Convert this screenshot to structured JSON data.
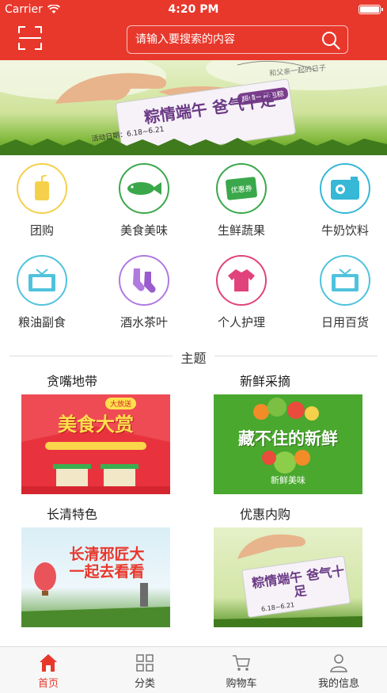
{
  "status_bar": {
    "carrier": "Carrier",
    "time": "4:20 PM"
  },
  "header": {
    "search_placeholder": "请输入要搜索的内容"
  },
  "banner": {
    "headline": "粽情端午 爸气十足",
    "date_text": "活动日期：6.18~6.21",
    "tag_text": "超值一起包粽",
    "caption": "和父亲一起的日子"
  },
  "categories": [
    {
      "label": "团购",
      "icon": "cup-icon",
      "color": "#f5d04a"
    },
    {
      "label": "美食美味",
      "icon": "fish-icon",
      "color": "#3aa84a"
    },
    {
      "label": "生鲜蔬果",
      "icon": "coupon-icon",
      "color": "#3aa84a"
    },
    {
      "label": "牛奶饮料",
      "icon": "camera-icon",
      "color": "#36b8d6"
    },
    {
      "label": "粮油副食",
      "icon": "tv-icon",
      "color": "#4fc3dc"
    },
    {
      "label": "酒水茶叶",
      "icon": "socks-icon",
      "color": "#b07adf"
    },
    {
      "label": "个人护理",
      "icon": "shirt-icon",
      "color": "#e2427c"
    },
    {
      "label": "日用百货",
      "icon": "tv-icon",
      "color": "#4fc3dc"
    }
  ],
  "coupon_text": "优惠券",
  "section_title": "主题",
  "themes": [
    {
      "label": "贪嘴地带",
      "image_text": "美食大赏",
      "badge": "大放送"
    },
    {
      "label": "新鲜采摘",
      "image_text": "藏不住的新鲜",
      "sub": "新鲜美味"
    },
    {
      "label": "长清特色",
      "image_text": "长清邪匠大 一起去看看"
    },
    {
      "label": "优惠内购",
      "image_text": "粽情端午 爸气十足",
      "date_text": "6.18~6.21"
    }
  ],
  "tabs": [
    {
      "label": "首页",
      "icon": "home-icon",
      "active": true
    },
    {
      "label": "分类",
      "icon": "grid-icon",
      "active": false
    },
    {
      "label": "购物车",
      "icon": "cart-icon",
      "active": false
    },
    {
      "label": "我的信息",
      "icon": "user-icon",
      "active": false
    }
  ],
  "colors": {
    "brand": "#e8382c",
    "tab_active": "#e8382c"
  }
}
